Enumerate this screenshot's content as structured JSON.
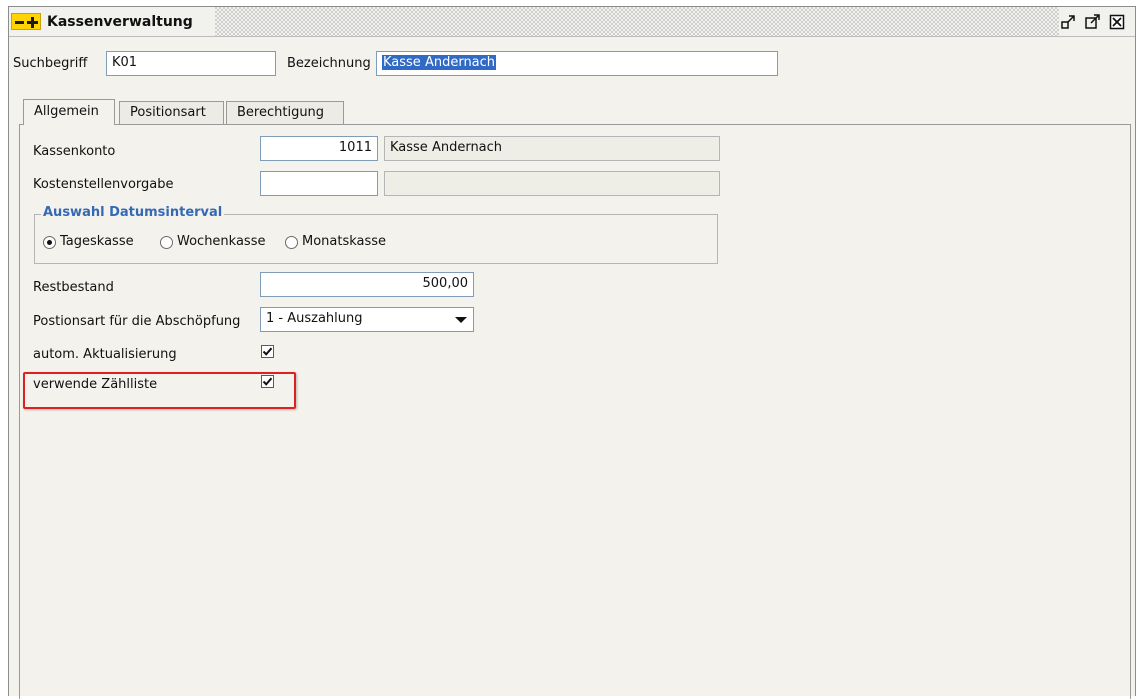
{
  "window": {
    "title": "Kassenverwaltung"
  },
  "header": {
    "search_label": "Suchbegriff",
    "search_value": "K01",
    "name_label": "Bezeichnung",
    "name_value": "Kasse Andernach"
  },
  "tabs": [
    {
      "label": "Allgemein",
      "active": true
    },
    {
      "label": "Positionsart",
      "active": false
    },
    {
      "label": "Berechtigung",
      "active": false
    }
  ],
  "form": {
    "kassenkonto_label": "Kassenkonto",
    "kassenkonto_value": "1011",
    "kassenkonto_name": "Kasse Andernach",
    "kostenstelle_label": "Kostenstellenvorgabe",
    "kostenstelle_value": "",
    "kostenstelle_name": "",
    "group_title": "Auswahl Datumsinterval",
    "radio_options": [
      {
        "label": "Tageskasse",
        "selected": true
      },
      {
        "label": "Wochenkasse",
        "selected": false
      },
      {
        "label": "Monatskasse",
        "selected": false
      }
    ],
    "restbestand_label": "Restbestand",
    "restbestand_value": "500,00",
    "positionsart_label": "Postionsart für die Abschöpfung",
    "positionsart_value": "1 - Auszahlung",
    "auto_update_label": "autom. Aktualisierung",
    "auto_update_checked": true,
    "zaehlliste_label": "verwende Zählliste",
    "zaehlliste_checked": true
  },
  "colors": {
    "group_title": "#3569b5",
    "highlight_border": "#e02020",
    "selection": "#316ac5",
    "icon_yellow": "#ffd400"
  },
  "icons": {
    "app": "kasse-plus-minus-icon",
    "restore": "restore-window-icon",
    "maximize": "maximize-window-icon",
    "close": "close-window-icon"
  }
}
